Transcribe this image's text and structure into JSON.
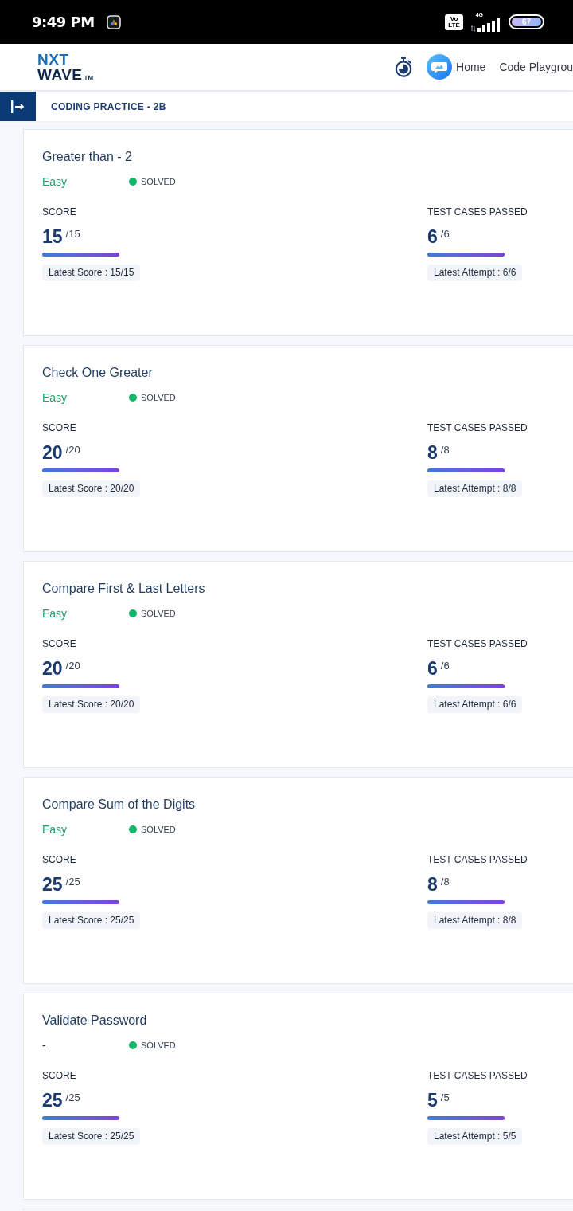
{
  "status_bar": {
    "time": "9:49 PM",
    "volte": [
      "Vo",
      "LTE"
    ],
    "network": "4G",
    "battery": "67"
  },
  "header": {
    "logo": {
      "line_1": "NXT",
      "line_2": "WAVE",
      "trademark": "TM"
    },
    "nav_links": [
      "Home",
      "Code Playgrou"
    ]
  },
  "page_title": "CODING PRACTICE - 2B",
  "problems": [
    {
      "title": "Greater than - 2",
      "difficulty": {
        "label": "Easy",
        "color": "#22a06b"
      },
      "status": {
        "label": "SOLVED",
        "color": "#12b76a"
      },
      "score": {
        "label": "SCORE",
        "value": "15",
        "total": "/15",
        "level": 1,
        "latest": "Latest Score : 15/15"
      },
      "test_cases": {
        "label": "TEST CASES PASSED",
        "value": "6",
        "total": "/6",
        "level": 1,
        "latest": "Latest Attempt : 6/6"
      }
    },
    {
      "title": "Check One Greater",
      "difficulty": {
        "label": "Easy",
        "color": "#22a06b"
      },
      "status": {
        "label": "SOLVED",
        "color": "#12b76a"
      },
      "score": {
        "label": "SCORE",
        "value": "20",
        "total": "/20",
        "level": 1,
        "latest": "Latest Score : 20/20"
      },
      "test_cases": {
        "label": "TEST CASES PASSED",
        "value": "8",
        "total": "/8",
        "level": 1,
        "latest": "Latest Attempt : 8/8"
      }
    },
    {
      "title": "Compare First & Last Letters",
      "difficulty": {
        "label": "Easy",
        "color": "#22a06b"
      },
      "status": {
        "label": "SOLVED",
        "color": "#12b76a"
      },
      "score": {
        "label": "SCORE",
        "value": "20",
        "total": "/20",
        "level": 1,
        "latest": "Latest Score : 20/20"
      },
      "test_cases": {
        "label": "TEST CASES PASSED",
        "value": "6",
        "total": "/6",
        "level": 1,
        "latest": "Latest Attempt : 6/6"
      }
    },
    {
      "title": "Compare Sum of the Digits",
      "difficulty": {
        "label": "Easy",
        "color": "#22a06b"
      },
      "status": {
        "label": "SOLVED",
        "color": "#12b76a"
      },
      "score": {
        "label": "SCORE",
        "value": "25",
        "total": "/25",
        "level": 1,
        "latest": "Latest Score : 25/25"
      },
      "test_cases": {
        "label": "TEST CASES PASSED",
        "value": "8",
        "total": "/8",
        "level": 1,
        "latest": "Latest Attempt : 8/8"
      }
    },
    {
      "title": "Validate Password",
      "difficulty": {
        "label": "-",
        "color": "#1e293b"
      },
      "status": {
        "label": "SOLVED",
        "color": "#12b76a"
      },
      "score": {
        "label": "SCORE",
        "value": "25",
        "total": "/25",
        "level": 1,
        "latest": "Latest Score : 25/25"
      },
      "test_cases": {
        "label": "TEST CASES PASSED",
        "value": "5",
        "total": "/5",
        "level": 1,
        "latest": "Latest Attempt : 5/5"
      }
    }
  ]
}
